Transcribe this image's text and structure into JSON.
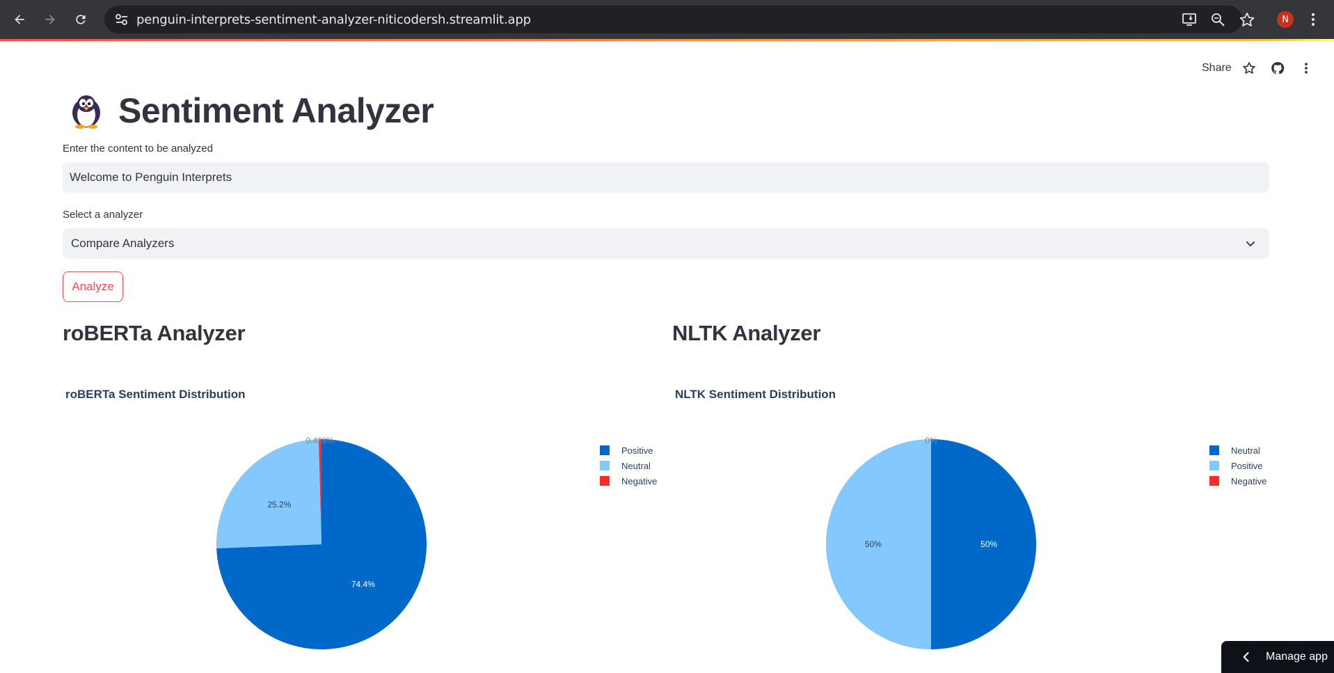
{
  "browser": {
    "url": "penguin-interprets-sentiment-analyzer-niticodersh.streamlit.app",
    "avatar_letter": "N"
  },
  "header": {
    "share_label": "Share"
  },
  "app": {
    "title": "Sentiment Analyzer",
    "title_emoji": "penguin",
    "text_input": {
      "label": "Enter the content to be analyzed",
      "value": "Welcome to Penguin Interprets"
    },
    "analyzer_select": {
      "label": "Select a analyzer",
      "value": "Compare Analyzers"
    },
    "analyze_button": "Analyze",
    "roberta": {
      "heading": "roBERTa Analyzer",
      "chart_title": "roBERTa Sentiment Distribution"
    },
    "nltk": {
      "heading": "NLTK Analyzer",
      "chart_title": "NLTK Sentiment Distribution"
    }
  },
  "manage_app_label": "Manage app",
  "colors": {
    "positive_roberta": "#0068c9",
    "neutral_roberta": "#83c9ff",
    "negative": "#ff2b2b",
    "accent": "#ff4b4b"
  },
  "chart_data": [
    {
      "type": "pie",
      "title": "roBERTa Sentiment Distribution",
      "categories": [
        "Positive",
        "Neutral",
        "Negative"
      ],
      "values": [
        74.4,
        25.2,
        0.428
      ],
      "value_labels": [
        "74.4%",
        "25.2%",
        "0.428%"
      ],
      "colors": [
        "#0068c9",
        "#83c9ff",
        "#ff2b2b"
      ],
      "legend": "top-right"
    },
    {
      "type": "pie",
      "title": "NLTK Sentiment Distribution",
      "categories": [
        "Neutral",
        "Positive",
        "Negative"
      ],
      "values": [
        50,
        50,
        0
      ],
      "value_labels": [
        "50%",
        "50%",
        "0%"
      ],
      "colors": [
        "#0068c9",
        "#83c9ff",
        "#ff2b2b"
      ],
      "legend": "top-right"
    }
  ]
}
